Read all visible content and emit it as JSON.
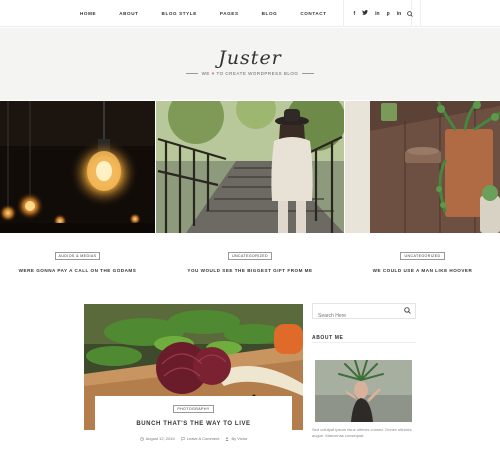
{
  "nav": {
    "items": [
      "HOME",
      "ABOUT",
      "BLOG STYLE",
      "PAGES",
      "BLOG",
      "CONTACT"
    ],
    "social": [
      "f",
      "t",
      "in",
      "p",
      "in"
    ]
  },
  "header": {
    "logo": "Juster",
    "tagline_prefix": "WE",
    "tagline_heart": "♥",
    "tagline_suffix": "TO CREATE WORDPRESS BLOG"
  },
  "slides": [
    {
      "category": "AUDIOS & MEDIAS",
      "title": "WERE GONNA PAY A CALL ON THE GODAMS"
    },
    {
      "category": "UNCATEGORIZED",
      "title": "YOU WOULD SEE THE BIGGEST GIFT FROM ME"
    },
    {
      "category": "UNCATEGORIZED",
      "title": "WE COULD USE A MAN LIKE HOOVER"
    }
  ],
  "post": {
    "category": "PHOTOGRAPHY",
    "title": "BUNCH THAT'S THE WAY TO LIVE",
    "date": "August 12, 2015",
    "comments": "Leave A Comment",
    "author": "By Victor"
  },
  "sidebar": {
    "search_placeholder": "Search Here",
    "about_title": "ABOUT ME",
    "about_text": "Sed volutpat ipsum risus ultrices consec. Donec ultricies augue. Maecenas consequat."
  },
  "colors": {
    "accent": "#e06a6a",
    "header_bg": "#f4f4f2"
  }
}
